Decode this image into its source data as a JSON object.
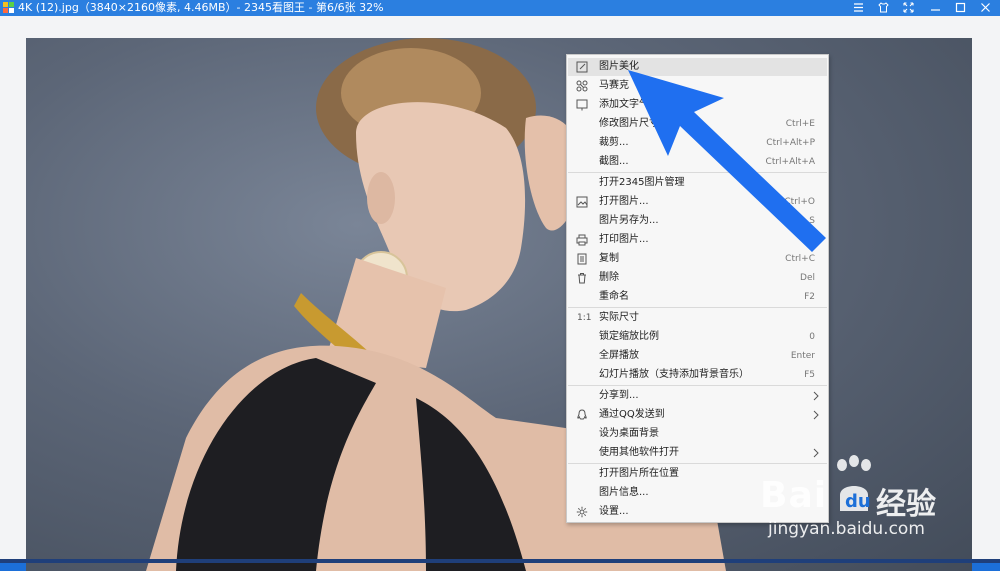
{
  "window": {
    "title": "4K (12).jpg（3840×2160像素, 4.46MB）- 2345看图王 - 第6/6张 32%"
  },
  "titlebar_icons": [
    "menu-icon",
    "skin-icon",
    "fullscreen-icon",
    "minimize-icon",
    "maximize-icon",
    "close-icon"
  ],
  "menu": {
    "items": [
      {
        "label": "图片美化",
        "shortcut": "",
        "icon": "edit-icon",
        "highlighted": true
      },
      {
        "label": "马赛克",
        "shortcut": "",
        "icon": "mosaic-icon"
      },
      {
        "label": "添加文字气泡",
        "shortcut": "",
        "icon": "text-bubble-icon"
      },
      {
        "label": "修改图片尺寸...",
        "shortcut": "Ctrl+E",
        "icon": ""
      },
      {
        "label": "裁剪...",
        "shortcut": "Ctrl+Alt+P",
        "icon": ""
      },
      {
        "label": "截图...",
        "shortcut": "Ctrl+Alt+A",
        "icon": ""
      },
      {
        "label": "打开2345图片管理",
        "shortcut": "",
        "icon": ""
      },
      {
        "label": "打开图片...",
        "shortcut": "Ctrl+O",
        "icon": "open-image-icon"
      },
      {
        "label": "图片另存为...",
        "shortcut": "S",
        "icon": ""
      },
      {
        "label": "打印图片...",
        "shortcut": "Ct",
        "icon": "print-icon"
      },
      {
        "label": "复制",
        "shortcut": "Ctrl+C",
        "icon": "copy-icon"
      },
      {
        "label": "删除",
        "shortcut": "Del",
        "icon": "trash-icon"
      },
      {
        "label": "重命名",
        "shortcut": "F2",
        "icon": ""
      },
      {
        "label": "实际尺寸",
        "shortcut": "",
        "icon": "actual-size-icon",
        "icon_text": "1:1"
      },
      {
        "label": "锁定缩放比例",
        "shortcut": "0",
        "icon": ""
      },
      {
        "label": "全屏播放",
        "shortcut": "Enter",
        "icon": ""
      },
      {
        "label": "幻灯片播放（支持添加背景音乐）",
        "shortcut": "F5",
        "icon": ""
      },
      {
        "label": "分享到...",
        "shortcut": "",
        "icon": "",
        "submenu": true
      },
      {
        "label": "通过QQ发送到",
        "shortcut": "",
        "icon": "qq-icon",
        "submenu": true
      },
      {
        "label": "设为桌面背景",
        "shortcut": "",
        "icon": ""
      },
      {
        "label": "使用其他软件打开",
        "shortcut": "",
        "icon": "",
        "submenu": true
      },
      {
        "label": "打开图片所在位置",
        "shortcut": "",
        "icon": ""
      },
      {
        "label": "图片信息...",
        "shortcut": "",
        "icon": ""
      },
      {
        "label": "设置...",
        "shortcut": "",
        "icon": "gear-icon"
      }
    ]
  },
  "watermark": {
    "brand": "Bai",
    "brand_cn": "经验",
    "url": "jingyan.baidu.com"
  },
  "colors": {
    "titlebar": "#2b7fe0",
    "annotation_arrow": "#1f6ff0",
    "menu_highlight": "#e3e3e3"
  }
}
